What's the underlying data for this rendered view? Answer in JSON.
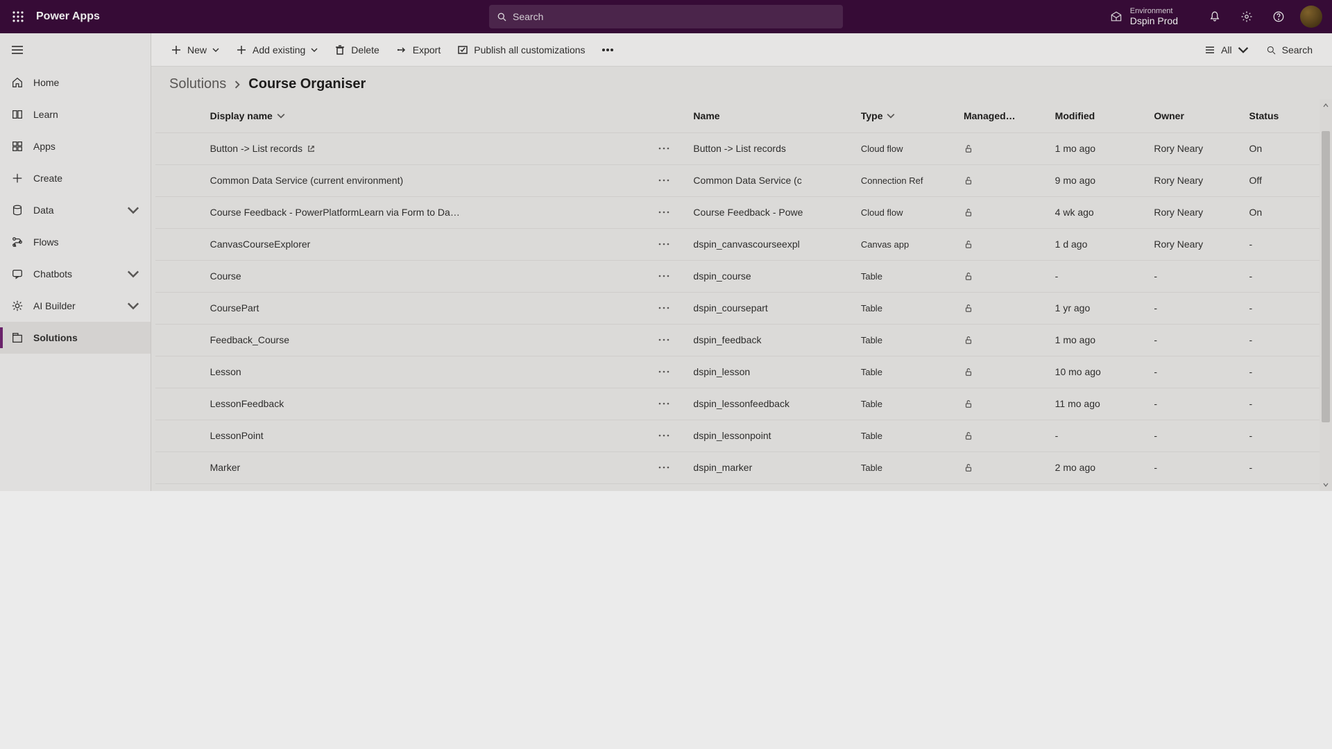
{
  "header": {
    "brand": "Power Apps",
    "search_placeholder": "Search",
    "environment_label": "Environment",
    "environment_value": "Dspin Prod"
  },
  "nav": {
    "items": [
      {
        "id": "home",
        "label": "Home"
      },
      {
        "id": "learn",
        "label": "Learn"
      },
      {
        "id": "apps",
        "label": "Apps"
      },
      {
        "id": "create",
        "label": "Create"
      },
      {
        "id": "data",
        "label": "Data",
        "expandable": true
      },
      {
        "id": "flows",
        "label": "Flows"
      },
      {
        "id": "chatbots",
        "label": "Chatbots",
        "expandable": true
      },
      {
        "id": "aibuilder",
        "label": "AI Builder",
        "expandable": true
      },
      {
        "id": "solutions",
        "label": "Solutions",
        "selected": true
      }
    ]
  },
  "commands": {
    "new": "New",
    "add_existing": "Add existing",
    "delete": "Delete",
    "export": "Export",
    "publish_all": "Publish all customizations",
    "filter_label": "All",
    "search_label": "Search"
  },
  "breadcrumb": {
    "root": "Solutions",
    "current": "Course Organiser"
  },
  "columns": {
    "display_name": "Display name",
    "name": "Name",
    "type": "Type",
    "managed": "Managed…",
    "modified": "Modified",
    "owner": "Owner",
    "status": "Status"
  },
  "rows": [
    {
      "display_name": "Button -> List records",
      "ext": true,
      "name": "Button -> List records",
      "type": "Cloud flow",
      "modified": "1 mo ago",
      "owner": "Rory Neary",
      "status": "On"
    },
    {
      "display_name": "Common Data Service (current environment)",
      "name": "Common Data Service (c",
      "type": "Connection Ref",
      "modified": "9 mo ago",
      "owner": "Rory Neary",
      "status": "Off"
    },
    {
      "display_name": "Course Feedback - PowerPlatformLearn via Form to Da…",
      "name": "Course Feedback - Powe",
      "type": "Cloud flow",
      "modified": "4 wk ago",
      "owner": "Rory Neary",
      "status": "On"
    },
    {
      "display_name": "CanvasCourseExplorer",
      "name": "dspin_canvascourseexpl",
      "type": "Canvas app",
      "modified": "1 d ago",
      "owner": "Rory Neary",
      "status": "-"
    },
    {
      "display_name": "Course",
      "name": "dspin_course",
      "type": "Table",
      "modified": "-",
      "owner": "-",
      "status": "-"
    },
    {
      "display_name": "CoursePart",
      "name": "dspin_coursepart",
      "type": "Table",
      "modified": "1 yr ago",
      "owner": "-",
      "status": "-"
    },
    {
      "display_name": "Feedback_Course",
      "name": "dspin_feedback",
      "type": "Table",
      "modified": "1 mo ago",
      "owner": "-",
      "status": "-"
    },
    {
      "display_name": "Lesson",
      "name": "dspin_lesson",
      "type": "Table",
      "modified": "10 mo ago",
      "owner": "-",
      "status": "-"
    },
    {
      "display_name": "LessonFeedback",
      "name": "dspin_lessonfeedback",
      "type": "Table",
      "modified": "11 mo ago",
      "owner": "-",
      "status": "-"
    },
    {
      "display_name": "LessonPoint",
      "name": "dspin_lessonpoint",
      "type": "Table",
      "modified": "-",
      "owner": "-",
      "status": "-"
    },
    {
      "display_name": "Marker",
      "name": "dspin_marker",
      "type": "Table",
      "modified": "2 mo ago",
      "owner": "-",
      "status": "-"
    }
  ]
}
